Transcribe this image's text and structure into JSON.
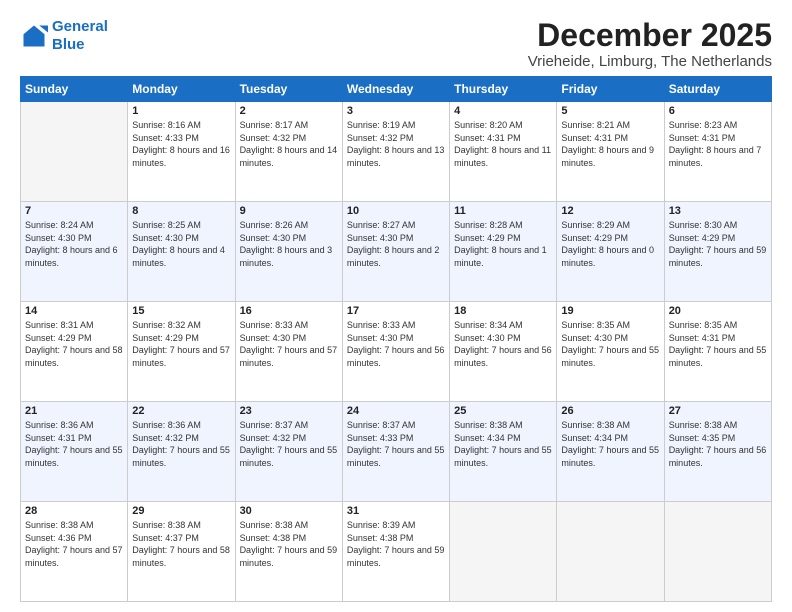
{
  "logo": {
    "line1": "General",
    "line2": "Blue"
  },
  "title": "December 2025",
  "location": "Vrieheide, Limburg, The Netherlands",
  "weekdays": [
    "Sunday",
    "Monday",
    "Tuesday",
    "Wednesday",
    "Thursday",
    "Friday",
    "Saturday"
  ],
  "weeks": [
    [
      {
        "day": "",
        "sunrise": "",
        "sunset": "",
        "daylight": ""
      },
      {
        "day": "1",
        "sunrise": "Sunrise: 8:16 AM",
        "sunset": "Sunset: 4:33 PM",
        "daylight": "Daylight: 8 hours and 16 minutes."
      },
      {
        "day": "2",
        "sunrise": "Sunrise: 8:17 AM",
        "sunset": "Sunset: 4:32 PM",
        "daylight": "Daylight: 8 hours and 14 minutes."
      },
      {
        "day": "3",
        "sunrise": "Sunrise: 8:19 AM",
        "sunset": "Sunset: 4:32 PM",
        "daylight": "Daylight: 8 hours and 13 minutes."
      },
      {
        "day": "4",
        "sunrise": "Sunrise: 8:20 AM",
        "sunset": "Sunset: 4:31 PM",
        "daylight": "Daylight: 8 hours and 11 minutes."
      },
      {
        "day": "5",
        "sunrise": "Sunrise: 8:21 AM",
        "sunset": "Sunset: 4:31 PM",
        "daylight": "Daylight: 8 hours and 9 minutes."
      },
      {
        "day": "6",
        "sunrise": "Sunrise: 8:23 AM",
        "sunset": "Sunset: 4:31 PM",
        "daylight": "Daylight: 8 hours and 7 minutes."
      }
    ],
    [
      {
        "day": "7",
        "sunrise": "Sunrise: 8:24 AM",
        "sunset": "Sunset: 4:30 PM",
        "daylight": "Daylight: 8 hours and 6 minutes."
      },
      {
        "day": "8",
        "sunrise": "Sunrise: 8:25 AM",
        "sunset": "Sunset: 4:30 PM",
        "daylight": "Daylight: 8 hours and 4 minutes."
      },
      {
        "day": "9",
        "sunrise": "Sunrise: 8:26 AM",
        "sunset": "Sunset: 4:30 PM",
        "daylight": "Daylight: 8 hours and 3 minutes."
      },
      {
        "day": "10",
        "sunrise": "Sunrise: 8:27 AM",
        "sunset": "Sunset: 4:30 PM",
        "daylight": "Daylight: 8 hours and 2 minutes."
      },
      {
        "day": "11",
        "sunrise": "Sunrise: 8:28 AM",
        "sunset": "Sunset: 4:29 PM",
        "daylight": "Daylight: 8 hours and 1 minute."
      },
      {
        "day": "12",
        "sunrise": "Sunrise: 8:29 AM",
        "sunset": "Sunset: 4:29 PM",
        "daylight": "Daylight: 8 hours and 0 minutes."
      },
      {
        "day": "13",
        "sunrise": "Sunrise: 8:30 AM",
        "sunset": "Sunset: 4:29 PM",
        "daylight": "Daylight: 7 hours and 59 minutes."
      }
    ],
    [
      {
        "day": "14",
        "sunrise": "Sunrise: 8:31 AM",
        "sunset": "Sunset: 4:29 PM",
        "daylight": "Daylight: 7 hours and 58 minutes."
      },
      {
        "day": "15",
        "sunrise": "Sunrise: 8:32 AM",
        "sunset": "Sunset: 4:29 PM",
        "daylight": "Daylight: 7 hours and 57 minutes."
      },
      {
        "day": "16",
        "sunrise": "Sunrise: 8:33 AM",
        "sunset": "Sunset: 4:30 PM",
        "daylight": "Daylight: 7 hours and 57 minutes."
      },
      {
        "day": "17",
        "sunrise": "Sunrise: 8:33 AM",
        "sunset": "Sunset: 4:30 PM",
        "daylight": "Daylight: 7 hours and 56 minutes."
      },
      {
        "day": "18",
        "sunrise": "Sunrise: 8:34 AM",
        "sunset": "Sunset: 4:30 PM",
        "daylight": "Daylight: 7 hours and 56 minutes."
      },
      {
        "day": "19",
        "sunrise": "Sunrise: 8:35 AM",
        "sunset": "Sunset: 4:30 PM",
        "daylight": "Daylight: 7 hours and 55 minutes."
      },
      {
        "day": "20",
        "sunrise": "Sunrise: 8:35 AM",
        "sunset": "Sunset: 4:31 PM",
        "daylight": "Daylight: 7 hours and 55 minutes."
      }
    ],
    [
      {
        "day": "21",
        "sunrise": "Sunrise: 8:36 AM",
        "sunset": "Sunset: 4:31 PM",
        "daylight": "Daylight: 7 hours and 55 minutes."
      },
      {
        "day": "22",
        "sunrise": "Sunrise: 8:36 AM",
        "sunset": "Sunset: 4:32 PM",
        "daylight": "Daylight: 7 hours and 55 minutes."
      },
      {
        "day": "23",
        "sunrise": "Sunrise: 8:37 AM",
        "sunset": "Sunset: 4:32 PM",
        "daylight": "Daylight: 7 hours and 55 minutes."
      },
      {
        "day": "24",
        "sunrise": "Sunrise: 8:37 AM",
        "sunset": "Sunset: 4:33 PM",
        "daylight": "Daylight: 7 hours and 55 minutes."
      },
      {
        "day": "25",
        "sunrise": "Sunrise: 8:38 AM",
        "sunset": "Sunset: 4:34 PM",
        "daylight": "Daylight: 7 hours and 55 minutes."
      },
      {
        "day": "26",
        "sunrise": "Sunrise: 8:38 AM",
        "sunset": "Sunset: 4:34 PM",
        "daylight": "Daylight: 7 hours and 55 minutes."
      },
      {
        "day": "27",
        "sunrise": "Sunrise: 8:38 AM",
        "sunset": "Sunset: 4:35 PM",
        "daylight": "Daylight: 7 hours and 56 minutes."
      }
    ],
    [
      {
        "day": "28",
        "sunrise": "Sunrise: 8:38 AM",
        "sunset": "Sunset: 4:36 PM",
        "daylight": "Daylight: 7 hours and 57 minutes."
      },
      {
        "day": "29",
        "sunrise": "Sunrise: 8:38 AM",
        "sunset": "Sunset: 4:37 PM",
        "daylight": "Daylight: 7 hours and 58 minutes."
      },
      {
        "day": "30",
        "sunrise": "Sunrise: 8:38 AM",
        "sunset": "Sunset: 4:38 PM",
        "daylight": "Daylight: 7 hours and 59 minutes."
      },
      {
        "day": "31",
        "sunrise": "Sunrise: 8:39 AM",
        "sunset": "Sunset: 4:38 PM",
        "daylight": "Daylight: 7 hours and 59 minutes."
      },
      {
        "day": "",
        "sunrise": "",
        "sunset": "",
        "daylight": ""
      },
      {
        "day": "",
        "sunrise": "",
        "sunset": "",
        "daylight": ""
      },
      {
        "day": "",
        "sunrise": "",
        "sunset": "",
        "daylight": ""
      }
    ]
  ]
}
